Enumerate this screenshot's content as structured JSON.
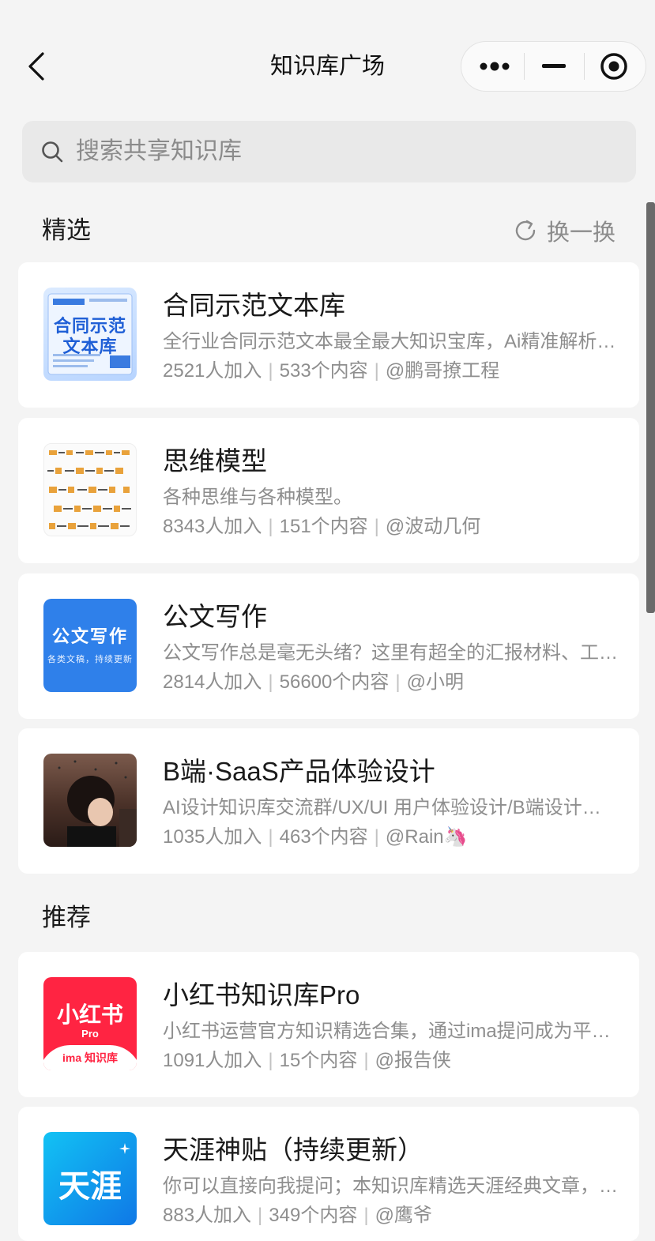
{
  "header": {
    "title": "知识库广场",
    "back_icon": "chevron-left-icon",
    "more_icon": "more-dots-icon",
    "minimize_icon": "minimize-icon",
    "close_icon": "target-circle-icon"
  },
  "search": {
    "placeholder": "搜索共享知识库",
    "icon": "search-icon"
  },
  "featured": {
    "title": "精选",
    "refresh_label": "换一换",
    "items": [
      {
        "title": "合同示范文本库",
        "desc": "全行业合同示范文本最全最大知识宝库，Ai精准解析…",
        "joined": "2521人加入",
        "count": "533个内容",
        "author": "@鹏哥撩工程",
        "thumb_text": "合同示范文本库"
      },
      {
        "title": "思维模型",
        "desc": "各种思维与各种模型。",
        "joined": "8343人加入",
        "count": "151个内容",
        "author": "@波动几何"
      },
      {
        "title": "公文写作",
        "desc": "公文写作总是毫无头绪？这里有超全的汇报材料、工…",
        "joined": "2814人加入",
        "count": "56600个内容",
        "author": "@小明",
        "thumb_text": "公文写作",
        "thumb_sub": "各类文稿，持续更新"
      },
      {
        "title": "B端·SaaS产品体验设计",
        "desc": "AI设计知识库交流群/UX/UI 用户体验设计/B端设计…",
        "joined": "1035人加入",
        "count": "463个内容",
        "author": "@Rain🦄"
      }
    ]
  },
  "recommended": {
    "title": "推荐",
    "items": [
      {
        "title": "小红书知识库Pro",
        "desc": "小红书运营官方知识精选合集，通过ima提问成为平…",
        "joined": "1091人加入",
        "count": "15个内容",
        "author": "@报告侠",
        "thumb_text": "小红书",
        "thumb_sub": "Pro",
        "thumb_tag": "ima 知识库"
      },
      {
        "title": "天涯神贴（持续更新）",
        "desc": "你可以直接向我提问；本知识库精选天涯经典文章，…",
        "joined": "883人加入",
        "count": "349个内容",
        "author": "@鹰爷",
        "thumb_text": "天涯"
      }
    ]
  },
  "colors": {
    "background": "#f4f4f4",
    "card": "#ffffff",
    "muted_text": "#8e8e8e",
    "brand_blue": "#2f80ea",
    "brand_red": "#ff2442"
  },
  "meta_separator": "|"
}
